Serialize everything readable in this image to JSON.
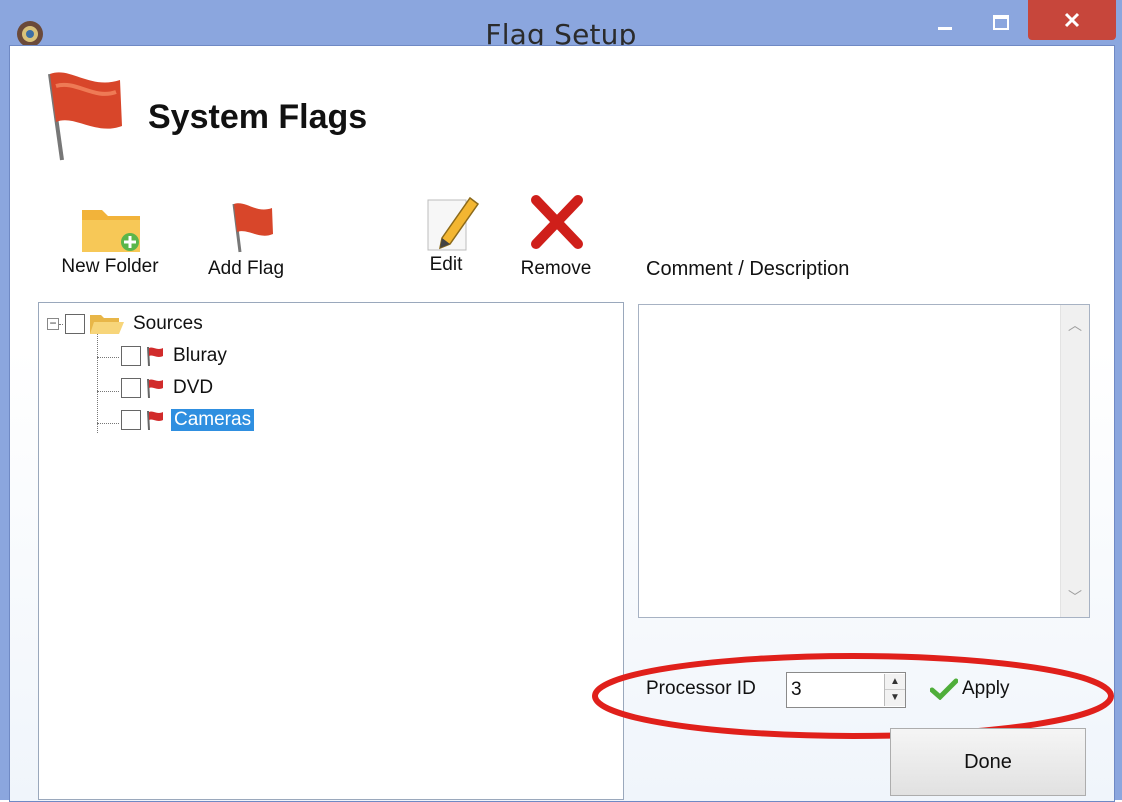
{
  "window": {
    "title": "Flag Setup"
  },
  "header": {
    "title": "System Flags"
  },
  "toolbar": {
    "new_folder": "New Folder",
    "add_flag": "Add Flag",
    "edit": "Edit",
    "remove": "Remove"
  },
  "comment": {
    "label": "Comment / Description",
    "value": ""
  },
  "tree": {
    "root": {
      "label": "Sources",
      "checked": false,
      "expanded": true
    },
    "items": [
      {
        "label": "Bluray",
        "checked": false,
        "selected": false
      },
      {
        "label": "DVD",
        "checked": false,
        "selected": false
      },
      {
        "label": "Cameras",
        "checked": false,
        "selected": true
      }
    ]
  },
  "processor": {
    "label": "Processor ID",
    "value": "3"
  },
  "apply": {
    "label": "Apply"
  },
  "done": {
    "label": "Done"
  },
  "colors": {
    "titlebar": "#8ba6de",
    "close_button": "#c7463b",
    "selection": "#2f8fe0",
    "highlight_ellipse": "#e0201b",
    "flag_red": "#d8462a"
  },
  "icons": [
    "app-icon",
    "flag-icon",
    "folder-add-icon",
    "pencil-icon",
    "remove-x-icon",
    "checkmark-icon"
  ]
}
